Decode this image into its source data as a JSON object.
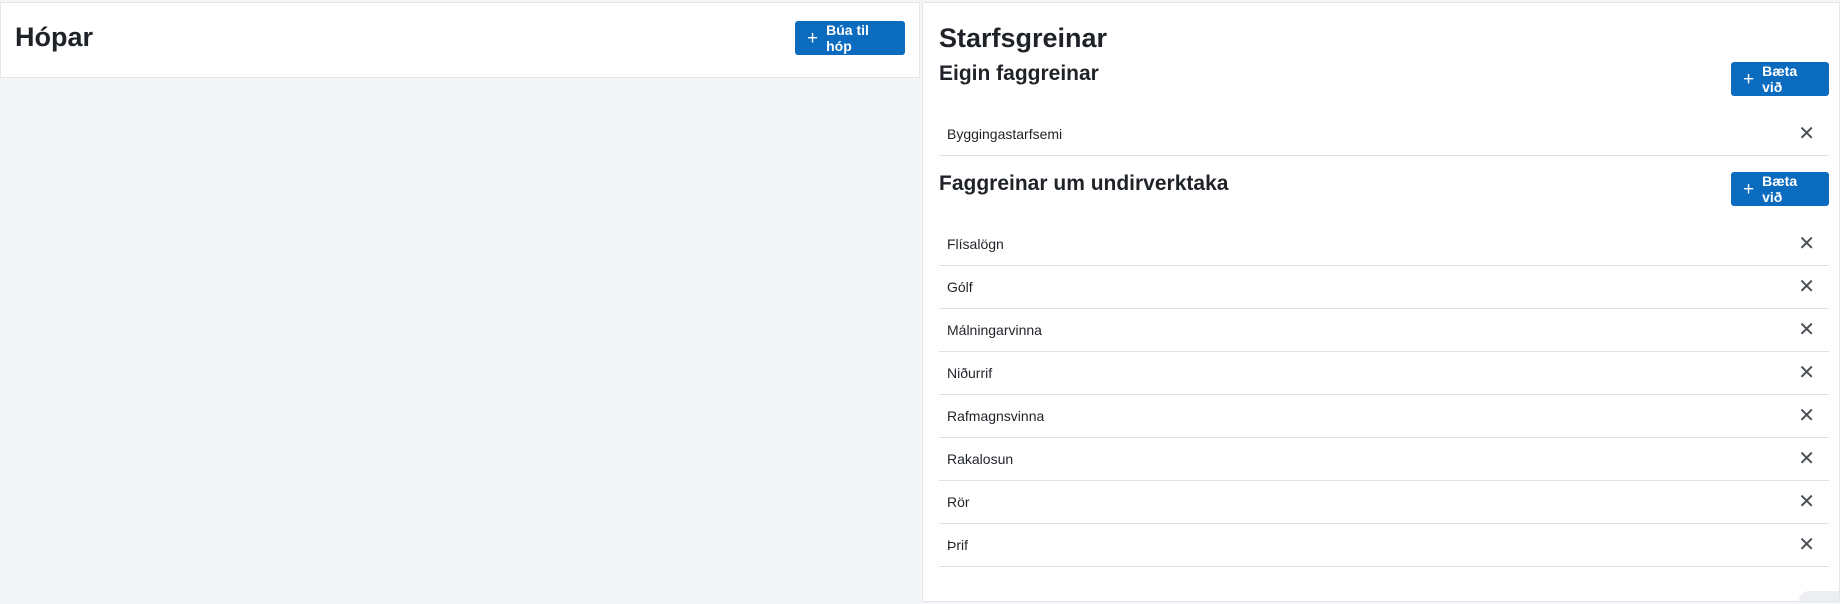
{
  "groups": {
    "title": "Hópar",
    "create_button_label": "Búa til hóp"
  },
  "trades": {
    "title": "Starfsgreinar",
    "own": {
      "title": "Eigin faggreinar",
      "add_button_label": "Bæta við",
      "items": [
        "Byggingastarfsemi"
      ]
    },
    "subcontractors": {
      "title": "Faggreinar um undirverktaka",
      "add_button_label": "Bæta við",
      "items": [
        "Flísalögn",
        "Gólf",
        "Málningarvinna",
        "Niðurrif",
        "Rafmagnsvinna",
        "Rakalosun",
        "Rör",
        "Þrif"
      ]
    }
  },
  "icons": {
    "add": "plus-icon",
    "remove": "close-icon"
  },
  "colors": {
    "primary": "#0b6bbf",
    "background": "#f4f5f7"
  }
}
